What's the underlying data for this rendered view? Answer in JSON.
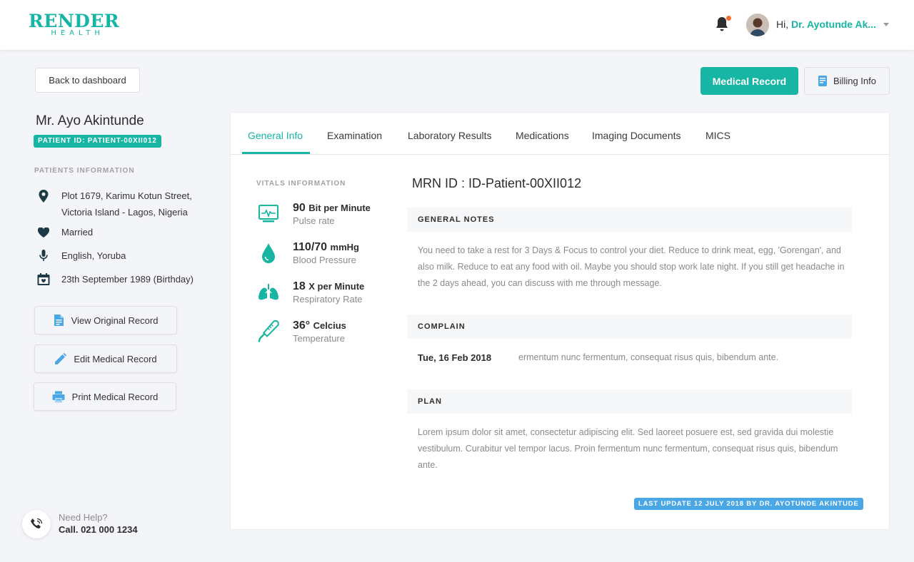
{
  "brand": {
    "line1": "RENDER",
    "line2": "HEALTH",
    "color": "#16b5a4"
  },
  "header": {
    "greeting": "Hi,",
    "user_name": "Dr. Ayotunde Ak...",
    "icons": [
      "bell-icon",
      "avatar",
      "chevron-down-icon"
    ]
  },
  "toolbar": {
    "back_label": "Back to dashboard",
    "medical_record_label": "Medical Record",
    "billing_info_label": "Billing Info"
  },
  "patient": {
    "name": "Mr. Ayo Akintunde",
    "id_badge": "PATIENT ID: PATIENT-00XII012",
    "section_label": "PATIENTS INFORMATION",
    "address_line1": "Plot 1679, Karimu Kotun Street,",
    "address_line2": "Victoria Island - Lagos, Nigeria",
    "marital_status": "Married",
    "languages": "English, Yoruba",
    "birthday": "23th September 1989 (Birthday)"
  },
  "actions": {
    "view_original": "View Original Record",
    "edit_record": "Edit Medical Record",
    "print_record": "Print Medical Record"
  },
  "help": {
    "title": "Need Help?",
    "phone": "Call. 021 000 1234"
  },
  "tabs": [
    {
      "label": "General Info",
      "active": true
    },
    {
      "label": "Examination"
    },
    {
      "label": "Laboratory Results"
    },
    {
      "label": "Medications"
    },
    {
      "label": "Imaging Documents"
    },
    {
      "label": "MICS"
    }
  ],
  "vitals": {
    "section_label": "VITALS INFORMATION",
    "items": [
      {
        "value": "90",
        "unit": "Bit per Minute",
        "label": "Pulse rate",
        "icon": "pulse-monitor-icon"
      },
      {
        "value": "110/70",
        "unit": "mmHg",
        "label": "Blood Pressure",
        "icon": "blood-drop-icon"
      },
      {
        "value": "18",
        "unit": "X per Minute",
        "label": "Respiratory Rate",
        "icon": "lungs-icon"
      },
      {
        "value": "36°",
        "unit": "Celcius",
        "label": "Temperature",
        "icon": "thermometer-icon"
      }
    ]
  },
  "record": {
    "mrn": "MRN ID : ID-Patient-00XII012",
    "general_notes_title": "GENERAL NOTES",
    "general_notes": "You need to take a rest for 3 Days & Focus to control your diet. Reduce to drink meat, egg, 'Gorengan', and also milk. Reduce to eat any food with oil. Maybe you should stop work late night. If you still get headache in the 2 days ahead, you can discuss with me through message.",
    "complain_title": "COMPLAIN",
    "complain_date": "Tue, 16 Feb 2018",
    "complain_text": "ermentum nunc fermentum, consequat risus quis, bibendum ante.",
    "plan_title": "PLAN",
    "plan_text": "Lorem ipsum dolor sit amet, consectetur adipiscing elit. Sed laoreet posuere est, sed gravida dui molestie vestibulum. Curabitur vel tempor lacus. Proin fermentum nunc fermentum, consequat risus quis, bibendum ante.",
    "last_update": "LAST UPDATE 12 JULY 2018 BY DR. AYOTUNDE AKINTUDE"
  },
  "colors": {
    "accent": "#16b5a4",
    "badge_blue": "#4aa7e6",
    "notification_dot": "#f56d2f",
    "icon_dark": "#1d3b47"
  }
}
